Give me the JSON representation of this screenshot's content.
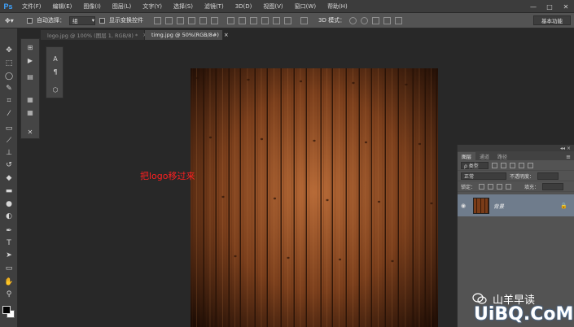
{
  "app": {
    "logo": "Ps"
  },
  "menu": [
    "文件(F)",
    "编辑(E)",
    "图像(I)",
    "图层(L)",
    "文字(Y)",
    "选择(S)",
    "滤镜(T)",
    "3D(D)",
    "视图(V)",
    "窗口(W)",
    "帮助(H)"
  ],
  "window_controls": {
    "minimize": "—",
    "maximize": "□",
    "close": "✕"
  },
  "options_bar": {
    "auto_select_label": "自动选择：",
    "auto_select_value": "组",
    "show_transform_label": "显示变换控件",
    "mode_3d_label": "3D 模式：",
    "workspace": "基本功能"
  },
  "tabs": [
    {
      "label": "logo.jpg @ 100% (图层 1, RGB/8) *",
      "active": false,
      "close": "×"
    },
    {
      "label": "timg.jpg @ 50%(RGB/8#)",
      "active": true,
      "close": "×"
    }
  ],
  "annotation": "把logo移过来",
  "layers_panel": {
    "collapse": "◂◂ ×",
    "tabs": [
      "图层",
      "通道",
      "路径"
    ],
    "menu_icon": "≡",
    "filter_label": "ρ 类型",
    "blend_mode": "正常",
    "opacity_label": "不透明度：",
    "lock_label": "锁定：",
    "fill_label": "填充：",
    "layer": {
      "name": "背景",
      "visible_icon": "◉",
      "lock_icon": "🔒"
    }
  },
  "watermark": {
    "account": "山羊早读",
    "site": "UiBQ.CoM"
  },
  "colors": {
    "accent": "#3fa3ff",
    "annotation": "#ff2020",
    "selected_layer": "#6f7c8c"
  }
}
